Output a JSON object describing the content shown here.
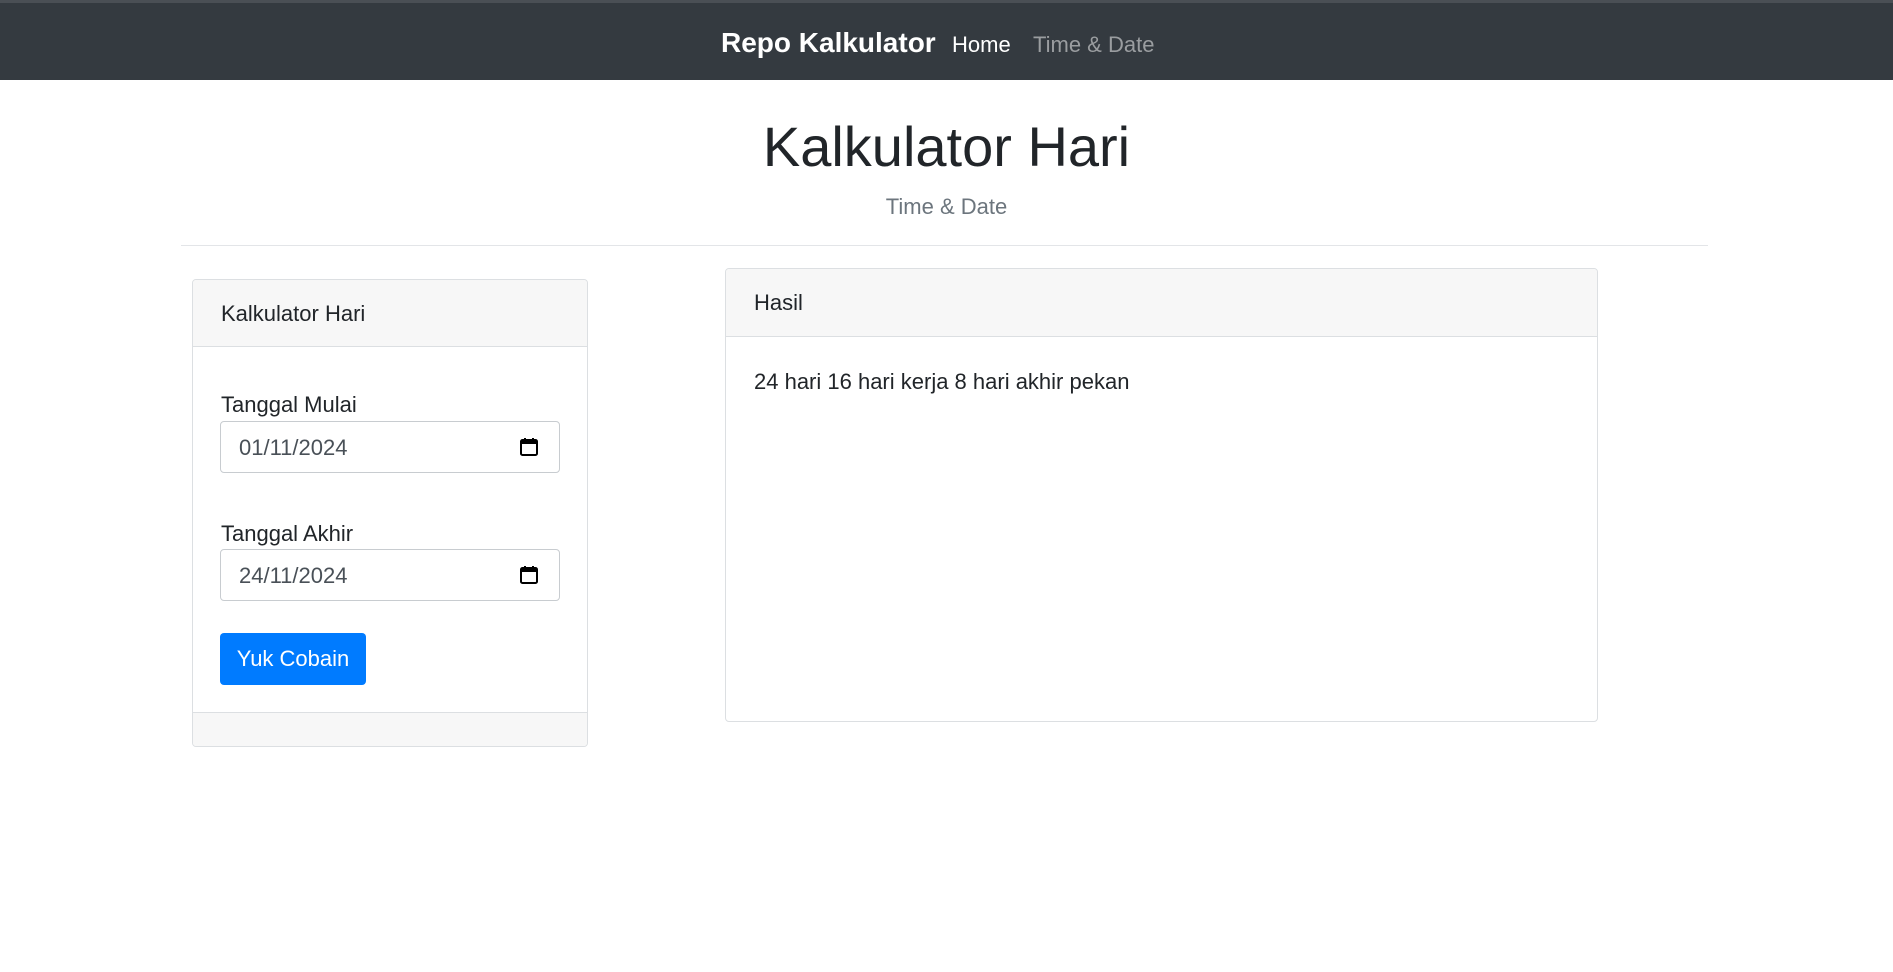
{
  "navbar": {
    "brand": "Repo Kalkulator",
    "links": [
      {
        "label": "Home",
        "active": true
      },
      {
        "label": "Time & Date",
        "active": false
      }
    ]
  },
  "header": {
    "title": "Kalkulator Hari",
    "subtitle": "Time & Date"
  },
  "calculator": {
    "title": "Kalkulator Hari",
    "start_label": "Tanggal Mulai",
    "start_value": "01/11/2024",
    "end_label": "Tanggal Akhir",
    "end_value": "24/11/2024",
    "submit_label": "Yuk Cobain"
  },
  "result": {
    "title": "Hasil",
    "text": "24 hari 16 hari kerja 8 hari akhir pekan"
  },
  "colors": {
    "navbar_bg": "#343a40",
    "primary": "#007bff",
    "muted": "#6c757d"
  },
  "icons": {
    "date_picker": "calendar-icon"
  }
}
